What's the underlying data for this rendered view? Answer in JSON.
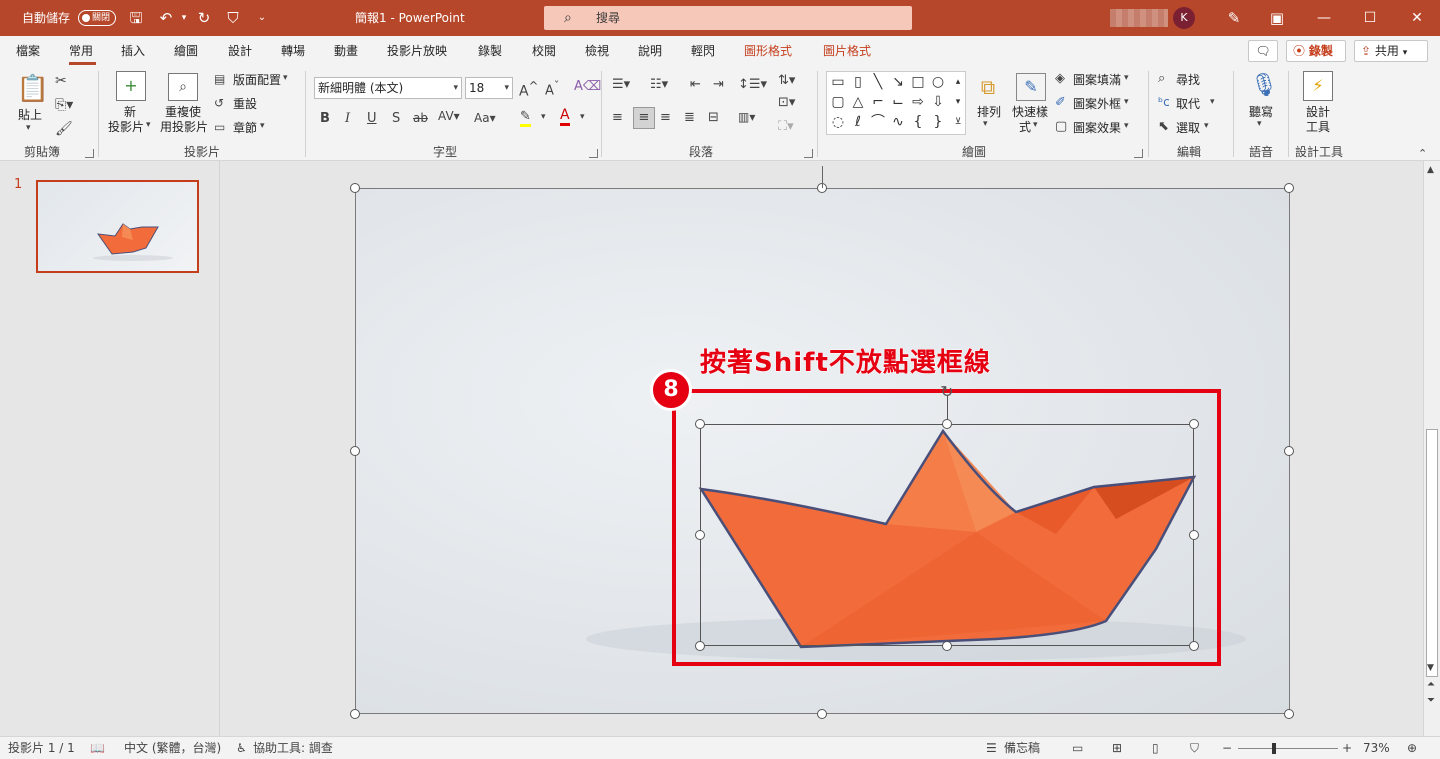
{
  "titlebar": {
    "autosave_label": "自動儲存",
    "autosave_state": "關閉",
    "doc_title": "簡報1 - PowerPoint",
    "search_placeholder": "搜尋",
    "avatar_initial": "K"
  },
  "tabs": [
    "檔案",
    "常用",
    "插入",
    "繪圖",
    "設計",
    "轉場",
    "動畫",
    "投影片放映",
    "錄製",
    "校閱",
    "檢視",
    "說明",
    "輕閃"
  ],
  "context_tabs": [
    "圖形格式",
    "圖片格式"
  ],
  "header_buttons": {
    "record": "錄製",
    "share": "共用"
  },
  "ribbon": {
    "clipboard": {
      "paste": "貼上",
      "group": "剪貼簿"
    },
    "slides": {
      "new_slide_1": "新",
      "new_slide_2": "投影片",
      "reuse_1": "重複使",
      "reuse_2": "用投影片",
      "layout": "版面配置",
      "reset": "重設",
      "section": "章節",
      "group": "投影片"
    },
    "font": {
      "name": "新細明體 (本文)",
      "size": "18",
      "group": "字型"
    },
    "paragraph": {
      "group": "段落"
    },
    "drawing": {
      "arrange": "排列",
      "quick_styles_1": "快速樣",
      "quick_styles_2": "式",
      "fill": "圖案填滿",
      "outline": "圖案外框",
      "effects": "圖案效果",
      "group": "繪圖"
    },
    "editing": {
      "find": "尋找",
      "replace": "取代",
      "select": "選取",
      "group": "編輯"
    },
    "voice": {
      "dictate": "聽寫",
      "group": "語音"
    },
    "designer": {
      "label_1": "設計",
      "label_2": "工具",
      "group": "設計工具"
    }
  },
  "slide_panel": {
    "slide_number": "1"
  },
  "annotation": {
    "badge": "8",
    "text": "按著Shift不放點選框線"
  },
  "statusbar": {
    "slide_info": "投影片 1 / 1",
    "language": "中文 (繁體，台灣)",
    "accessibility": "協助工具: 調查",
    "notes": "備忘稿",
    "zoom": "73%"
  },
  "colors": {
    "brand": "#b7472a",
    "context_tab": "#c43e1c",
    "annotation": "#e50012",
    "boat": "#f26b3a"
  }
}
